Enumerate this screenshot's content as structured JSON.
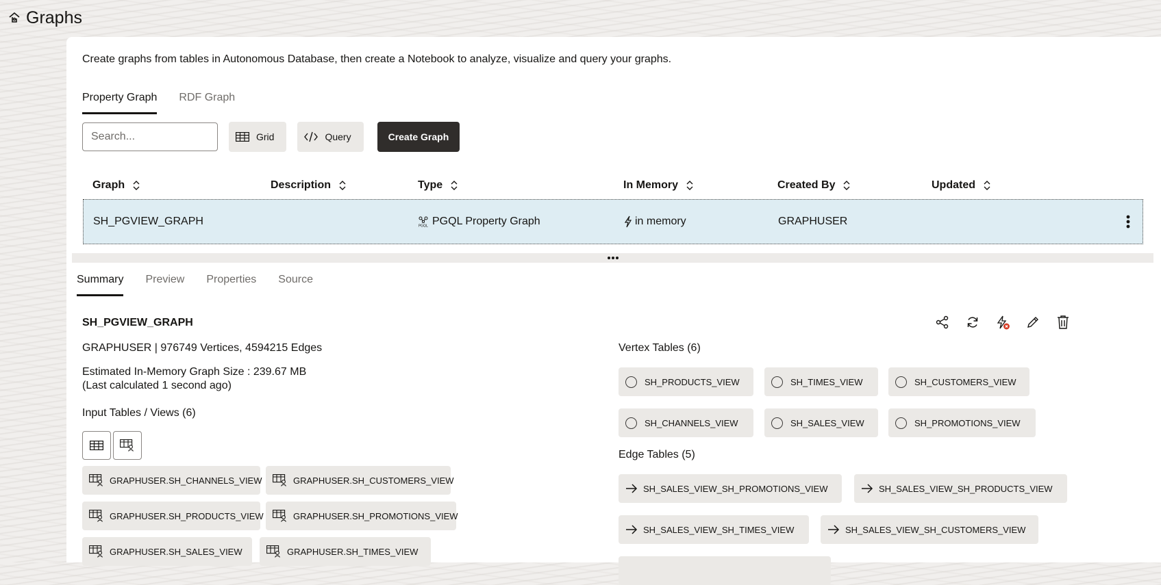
{
  "header": {
    "title": "Graphs",
    "icon": "graph-home-icon"
  },
  "intro": "Create graphs from tables in Autonomous Database, then create a Notebook to analyze, visualize and query your graphs.",
  "graph_type_tabs": [
    {
      "label": "Property Graph",
      "active": true
    },
    {
      "label": "RDF Graph",
      "active": false
    }
  ],
  "toolbar": {
    "search_placeholder": "Search...",
    "grid_label": "Grid",
    "query_label": "Query",
    "create_label": "Create Graph"
  },
  "table": {
    "columns": [
      "Graph",
      "Description",
      "Type",
      "In Memory",
      "Created By",
      "Updated"
    ],
    "rows": [
      {
        "graph": "SH_PGVIEW_GRAPH",
        "description": "",
        "type": "PGQL Property Graph",
        "in_memory": "in memory",
        "created_by": "GRAPHUSER",
        "updated": ""
      }
    ]
  },
  "detail_tabs": [
    {
      "label": "Summary",
      "active": true
    },
    {
      "label": "Preview",
      "active": false
    },
    {
      "label": "Properties",
      "active": false
    },
    {
      "label": "Source",
      "active": false
    }
  ],
  "summary": {
    "graph_name": "SH_PGVIEW_GRAPH",
    "stats": "GRAPHUSER | 976749 Vertices, 4594215 Edges",
    "size_line1": "Estimated In-Memory Graph Size : 239.67 MB",
    "size_line2": "(Last calculated 1 second ago)",
    "input_tables_heading": "Input Tables / Views (6)",
    "input_tables": [
      "GRAPHUSER.SH_CHANNELS_VIEW",
      "GRAPHUSER.SH_CUSTOMERS_VIEW",
      "GRAPHUSER.SH_PRODUCTS_VIEW",
      "GRAPHUSER.SH_PROMOTIONS_VIEW",
      "GRAPHUSER.SH_SALES_VIEW",
      "GRAPHUSER.SH_TIMES_VIEW"
    ],
    "vertex_heading": "Vertex Tables (6)",
    "vertex_tables": [
      "SH_PRODUCTS_VIEW",
      "SH_TIMES_VIEW",
      "SH_CUSTOMERS_VIEW",
      "SH_CHANNELS_VIEW",
      "SH_SALES_VIEW",
      "SH_PROMOTIONS_VIEW"
    ],
    "edge_heading": "Edge Tables (5)",
    "edge_tables": [
      "SH_SALES_VIEW_SH_PROMOTIONS_VIEW",
      "SH_SALES_VIEW_SH_PRODUCTS_VIEW",
      "SH_SALES_VIEW_SH_TIMES_VIEW",
      "SH_SALES_VIEW_SH_CUSTOMERS_VIEW"
    ]
  },
  "colors": {
    "selected_row": "#deedf3",
    "primary_button": "#302d2b",
    "chip_bg": "#ebe9e6",
    "alert_badge": "#d63b25"
  }
}
